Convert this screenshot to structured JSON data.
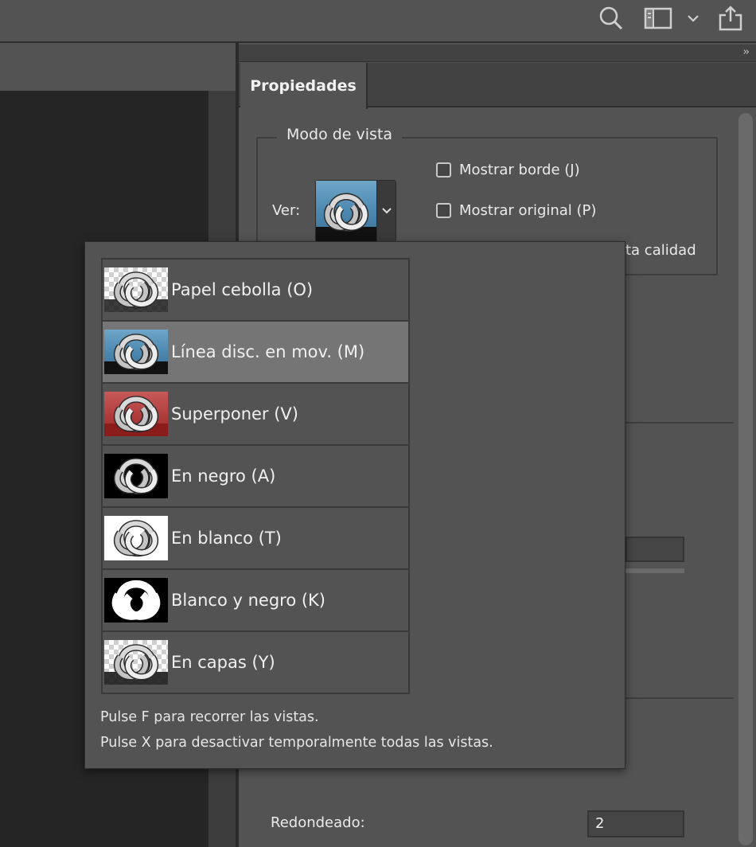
{
  "panel": {
    "tab_label": "Propiedades",
    "view_mode": {
      "legend": "Modo de vista",
      "ver_label": "Ver:",
      "options": [
        {
          "label": "Mostrar borde (J)",
          "checked": false
        },
        {
          "label": "Mostrar original (P)",
          "checked": false
        }
      ],
      "third_option_visible_text": "ta calidad"
    },
    "redondeado": {
      "label": "Redondeado:",
      "value": "2"
    }
  },
  "view_dropdown": {
    "items": [
      {
        "label": "Papel cebolla (O)",
        "thumb": "onion-skin"
      },
      {
        "label": "Línea disc. en mov. (M)",
        "thumb": "marching-ants",
        "selected": true
      },
      {
        "label": "Superponer (V)",
        "thumb": "overlay-red"
      },
      {
        "label": "En negro (A)",
        "thumb": "on-black"
      },
      {
        "label": "En blanco (T)",
        "thumb": "on-white"
      },
      {
        "label": "Blanco y negro (K)",
        "thumb": "black-white"
      },
      {
        "label": "En capas (Y)",
        "thumb": "on-layers"
      }
    ],
    "hints": [
      "Pulse F para recorrer las vistas.",
      "Pulse X para desactivar temporalmente todas las vistas."
    ]
  },
  "colors": {
    "panel_bg": "#535353",
    "canvas_bg": "#252525",
    "selected_row": "#757575",
    "overlay_red": "#a93535"
  }
}
